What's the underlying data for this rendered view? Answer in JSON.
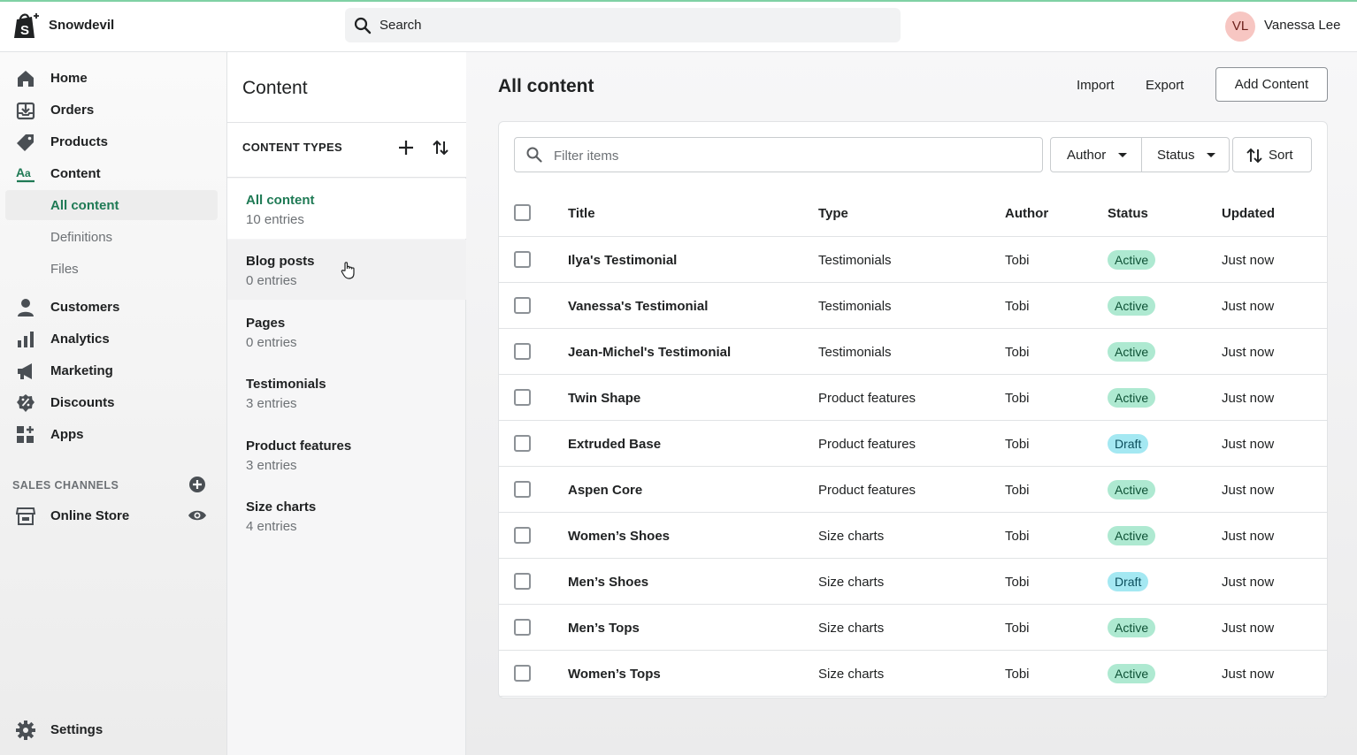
{
  "header": {
    "store_name": "Snowdevil",
    "search_label": "Search",
    "user_initials": "VL",
    "user_name": "Vanessa Lee"
  },
  "sidebar": {
    "items": [
      {
        "label": "Home",
        "icon": "home-icon"
      },
      {
        "label": "Orders",
        "icon": "orders-icon"
      },
      {
        "label": "Products",
        "icon": "tag-icon"
      },
      {
        "label": "Content",
        "icon": "content-icon"
      }
    ],
    "content_subitems": [
      {
        "label": "All content",
        "active": true
      },
      {
        "label": "Definitions",
        "active": false
      },
      {
        "label": "Files",
        "active": false
      }
    ],
    "items_after": [
      {
        "label": "Customers",
        "icon": "person-icon"
      },
      {
        "label": "Analytics",
        "icon": "bar-chart-icon"
      },
      {
        "label": "Marketing",
        "icon": "megaphone-icon"
      },
      {
        "label": "Discounts",
        "icon": "discount-icon"
      },
      {
        "label": "Apps",
        "icon": "apps-icon"
      }
    ],
    "sales_channels_title": "SALES CHANNELS",
    "online_store_label": "Online Store",
    "settings_label": "Settings"
  },
  "content_types": {
    "title": "Content",
    "subtitle": "CONTENT TYPES",
    "items": [
      {
        "name": "All content",
        "count": "10 entries"
      },
      {
        "name": "Blog posts",
        "count": "0 entries"
      },
      {
        "name": "Pages",
        "count": "0 entries"
      },
      {
        "name": "Testimonials",
        "count": "3 entries"
      },
      {
        "name": "Product features",
        "count": "3 entries"
      },
      {
        "name": "Size charts",
        "count": "4 entries"
      }
    ]
  },
  "main": {
    "title": "All content",
    "import_label": "Import",
    "export_label": "Export",
    "add_label": "Add Content",
    "filter_placeholder": "Filter items",
    "author_filter": "Author",
    "status_filter": "Status",
    "sort_label": "Sort",
    "columns": [
      "Title",
      "Type",
      "Author",
      "Status",
      "Updated"
    ],
    "rows": [
      {
        "title": "Ilya's Testimonial",
        "type": "Testimonials",
        "author": "Tobi",
        "status": "Active",
        "updated": "Just now"
      },
      {
        "title": "Vanessa's Testimonial",
        "type": "Testimonials",
        "author": "Tobi",
        "status": "Active",
        "updated": "Just now"
      },
      {
        "title": "Jean-Michel's Testimonial",
        "type": "Testimonials",
        "author": "Tobi",
        "status": "Active",
        "updated": "Just now"
      },
      {
        "title": "Twin Shape",
        "type": "Product features",
        "author": "Tobi",
        "status": "Active",
        "updated": "Just now"
      },
      {
        "title": "Extruded Base",
        "type": "Product features",
        "author": "Tobi",
        "status": "Draft",
        "updated": "Just now"
      },
      {
        "title": "Aspen Core",
        "type": "Product features",
        "author": "Tobi",
        "status": "Active",
        "updated": "Just now"
      },
      {
        "title": "Women’s Shoes",
        "type": "Size charts",
        "author": "Tobi",
        "status": "Active",
        "updated": "Just now"
      },
      {
        "title": "Men’s Shoes",
        "type": "Size charts",
        "author": "Tobi",
        "status": "Draft",
        "updated": "Just now"
      },
      {
        "title": "Men’s Tops",
        "type": "Size charts",
        "author": "Tobi",
        "status": "Active",
        "updated": "Just now"
      },
      {
        "title": "Women’s Tops",
        "type": "Size charts",
        "author": "Tobi",
        "status": "Active",
        "updated": "Just now"
      }
    ]
  },
  "colors": {
    "accent": "#1f7a55",
    "active_badge": "#aee9d1",
    "draft_badge": "#a4e8f2"
  }
}
